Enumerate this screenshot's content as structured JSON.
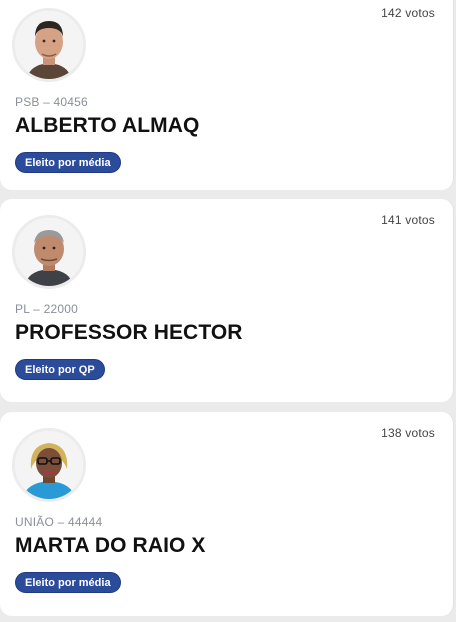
{
  "candidates": [
    {
      "votes": "142 votos",
      "party_number": "PSB – 40456",
      "name": "ALBERTO ALMAQ",
      "status": "Eleito por média"
    },
    {
      "votes": "141 votos",
      "party_number": "PL – 22000",
      "name": "PROFESSOR HECTOR",
      "status": "Eleito por QP"
    },
    {
      "votes": "138 votos",
      "party_number": "UNIÃO – 44444",
      "name": "MARTA DO RAIO X",
      "status": "Eleito por média"
    }
  ],
  "colors": {
    "badge": "#2b4b9b",
    "background": "#ebebeb",
    "card": "#ffffff"
  }
}
